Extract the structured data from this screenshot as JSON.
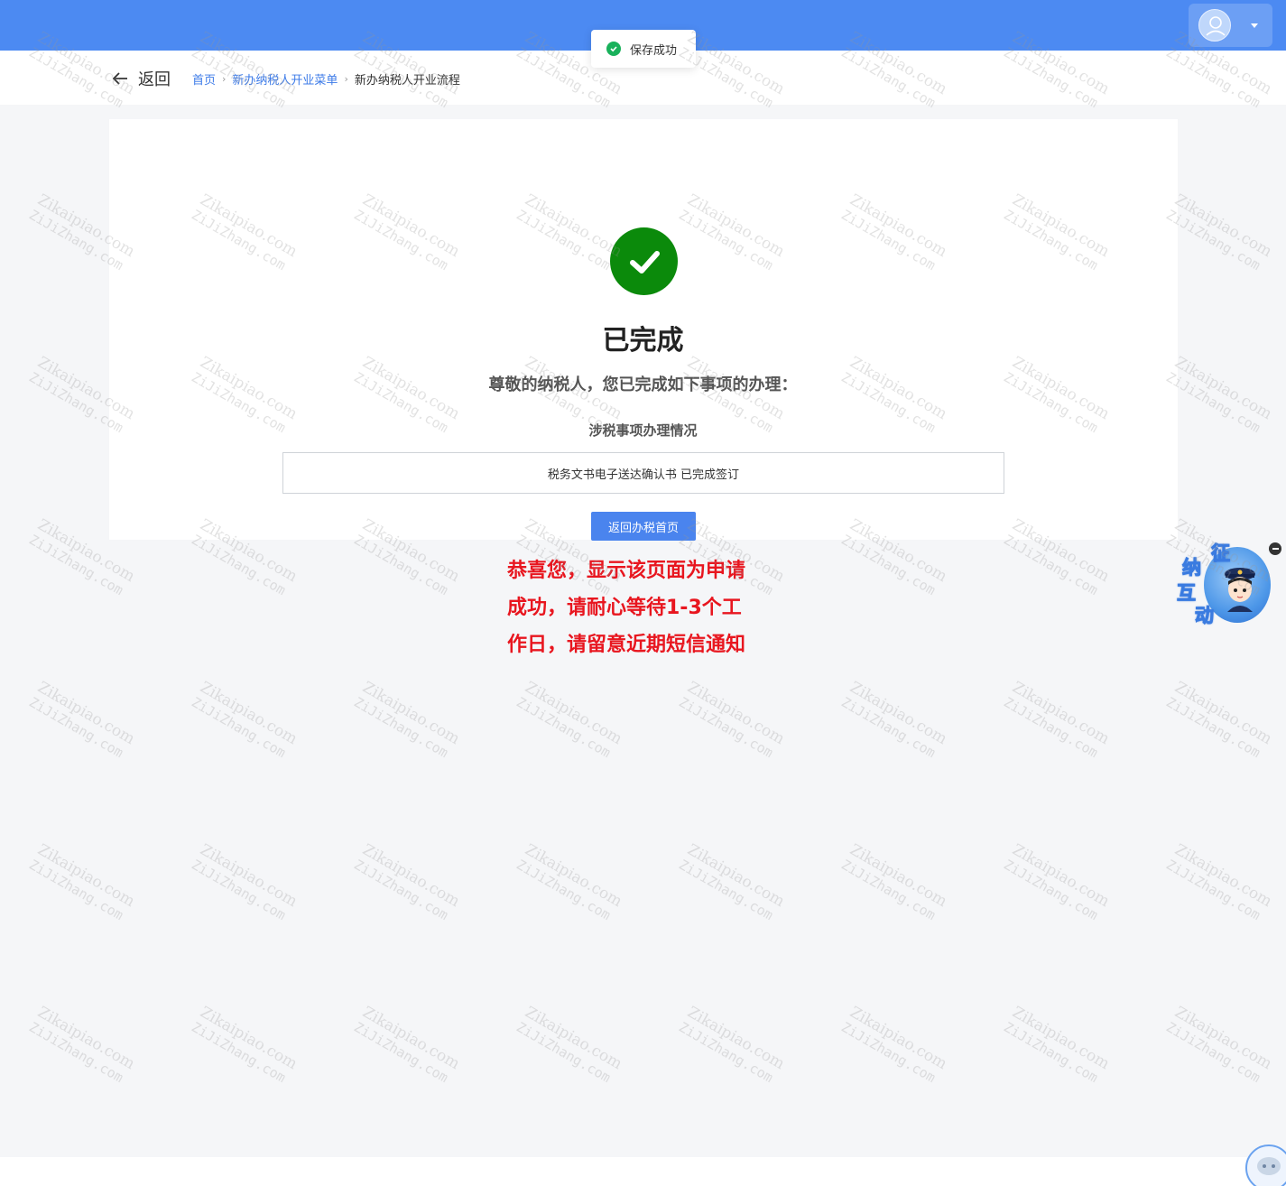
{
  "toast": {
    "text": "保存成功"
  },
  "navbar": {
    "back_label": "返回",
    "breadcrumbs": [
      "首页",
      "新办纳税人开业菜单",
      "新办纳税人开业流程"
    ]
  },
  "result": {
    "title": "已完成",
    "subtitle": "尊敬的纳税人，您已完成如下事项的办理：",
    "section_title": "涉税事项办理情况",
    "item_text": "税务文书电子送达确认书 已完成签订",
    "home_button": "返回办税首页"
  },
  "annotation": {
    "lines": [
      "恭喜您，显示该页面为申请",
      "成功，请耐心等待1-3个工",
      "作日，请留意近期短信通知"
    ]
  },
  "assistant": {
    "chars": [
      "征",
      "纳",
      "互",
      "动"
    ]
  },
  "watermark": {
    "line1": "Zikaipiao.com",
    "line2": "ZiJiZhang.com"
  },
  "colors": {
    "topbar": "#4c8af2",
    "success": "#0b8a0b",
    "primary_button": "#4a84ee",
    "annotation": "#e8161f"
  }
}
